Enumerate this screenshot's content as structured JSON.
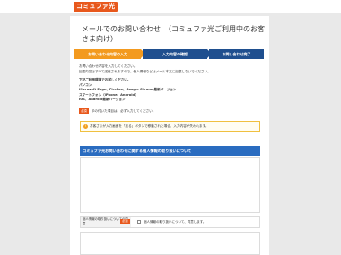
{
  "brand": {
    "logo_text": "コミュファ光"
  },
  "page": {
    "title": "メールでのお問い合わせ　（コミュファ光ご利用中のお客さま向け）"
  },
  "steps": [
    {
      "label": "お問い合わせ内容の入力"
    },
    {
      "label": "入力内容の確認"
    },
    {
      "label": "お問い合わせ完了"
    }
  ],
  "intro": {
    "line1": "お問い合わせ内容を入力してください。",
    "line2": "記載内容はすべて送信されますので、個人情報などはメール本文に記載しないでください。",
    "env_heading": "下記ご利用環境でお試しください。",
    "env1": "パソコン",
    "env2": "Microsoft Edge、FireFox、Google Chrome最新バージョン",
    "env3": "スマートフォン（iPhone、Android）",
    "env4": "iOS、Android最新バージョン"
  },
  "required_note": {
    "badge": "必須",
    "text": "印の付いた項目は、必ず入力してください。"
  },
  "notice": {
    "icon": "!",
    "text": "お客さまが入力画面を「戻る」ボタンで移動された場合、入力内容が失われます。"
  },
  "policy": {
    "heading": "コミュファ光お問い合わせに関する個人情報の取り扱いについて"
  },
  "agree": {
    "label": "個人情報の取り扱いについての同意",
    "badge": "必須",
    "checkbox_text": "個人情報の取り扱いについて、同意します。"
  },
  "colors": {
    "accent": "#e8581c",
    "step_active": "#f39a1f",
    "step_inactive": "#1f4f8f",
    "section": "#2a6cc0"
  }
}
